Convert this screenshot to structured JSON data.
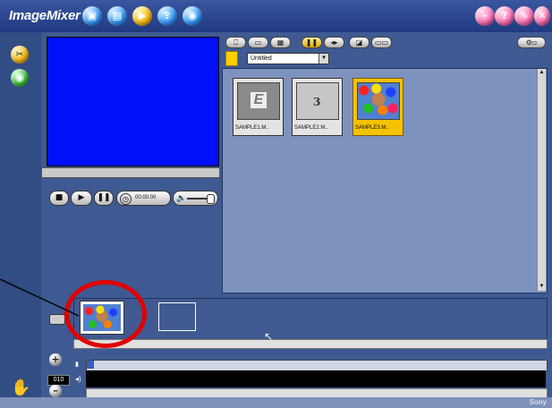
{
  "app": {
    "title": "ImageMixer",
    "brand": "Sony"
  },
  "colors": {
    "accent": "#3f5a92",
    "preview_bg": "#0010f8",
    "highlight_ring": "#e00000",
    "selected_thumb": "#f5c200"
  },
  "nav": {
    "icons": [
      "import-icon",
      "album-icon",
      "movie-icon",
      "export-icon",
      "photo-icon"
    ]
  },
  "window_controls": [
    "minimize-icon",
    "help-icon",
    "tools-icon",
    "close-icon"
  ],
  "left_tools": [
    "scissors-icon",
    "eye-icon"
  ],
  "player": {
    "timecode": "00:00:00"
  },
  "browser": {
    "album_name": "Untitled",
    "items": [
      {
        "label": "SAMPLE1.M..",
        "kind": "clip-gray"
      },
      {
        "label": "SAMPLE2.M..",
        "kind": "clip-countdown"
      },
      {
        "label": "SAMPLE3.M..",
        "kind": "clip-balls"
      }
    ]
  },
  "zoom": {
    "value": "010"
  }
}
